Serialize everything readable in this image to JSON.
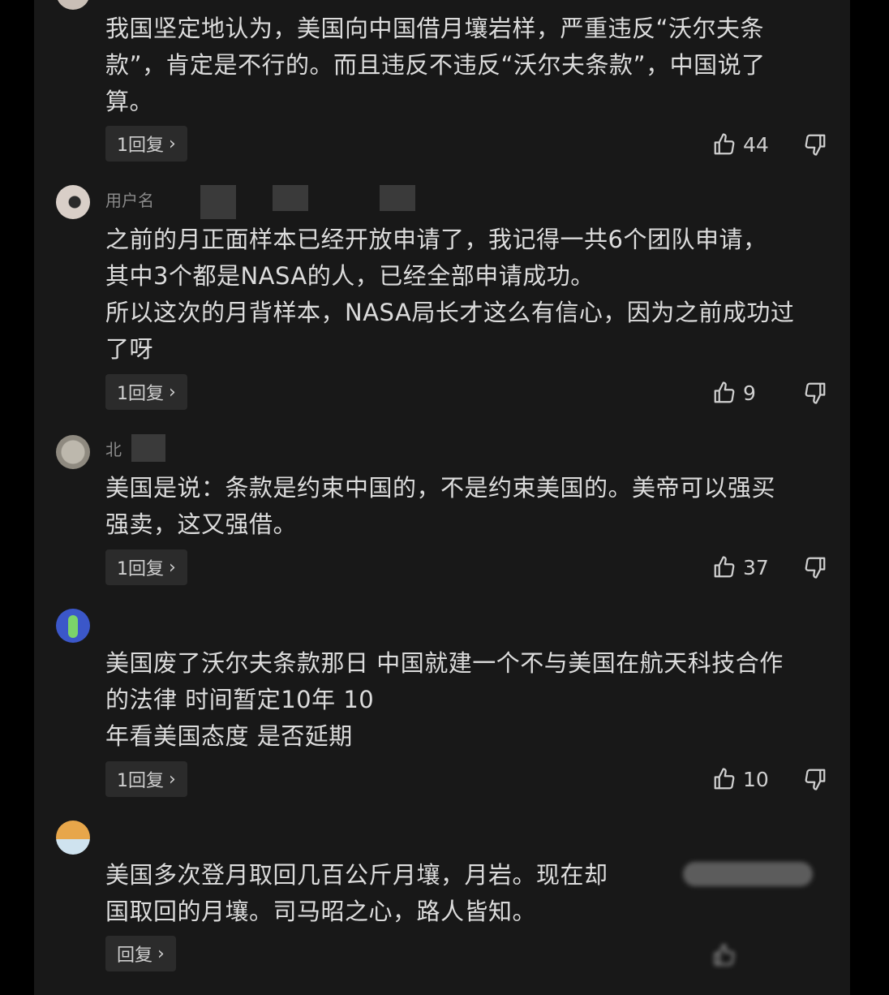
{
  "comments": [
    {
      "username": "",
      "text_lines": [
        "我国坚定地认为，美国向中国借月壤岩样，严重违反“沃尔夫条",
        "款”，肯定是不行的。而且违反不违反“沃尔夫条款”，中国说了",
        "算。"
      ],
      "reply_label": "1回复",
      "likes": "44"
    },
    {
      "username": "用户名",
      "text_lines": [
        "之前的月正面样本已经开放申请了，我记得一共6个团队申请，",
        "其中3个都是NASA的人，已经全部申请成功。",
        "所以这次的月背样本，NASA局长才这么有信心，因为之前成功过",
        "了呀"
      ],
      "reply_label": "1回复",
      "likes": "9"
    },
    {
      "username": "北",
      "text_lines": [
        "美国是说：条款是约束中国的，不是约束美国的。美帝可以强买",
        "强卖，这又强借。"
      ],
      "reply_label": "1回复",
      "likes": "37"
    },
    {
      "username": "",
      "text_lines": [
        "美国废了沃尔夫条款那日 中国就建一个不与美国在航天科技合作",
        "的法律 时间暂定10年 10",
        "年看美国态度 是否延期"
      ],
      "reply_label": "1回复",
      "likes": "10"
    },
    {
      "username": "",
      "text_lines": [
        "美国多次登月取回几百公斤月壤，月岩。现在却",
        "国取回的月壤。司马昭之心，路人皆知。"
      ],
      "reply_label": "回复",
      "likes": ""
    }
  ],
  "icons": {
    "like": "thumbs-up-icon",
    "dislike": "thumbs-down-icon",
    "chevron": "chevron-right-icon"
  },
  "colors": {
    "background": "#181818",
    "text": "#dcdcdc",
    "reply_button": "#2b2b2b"
  }
}
